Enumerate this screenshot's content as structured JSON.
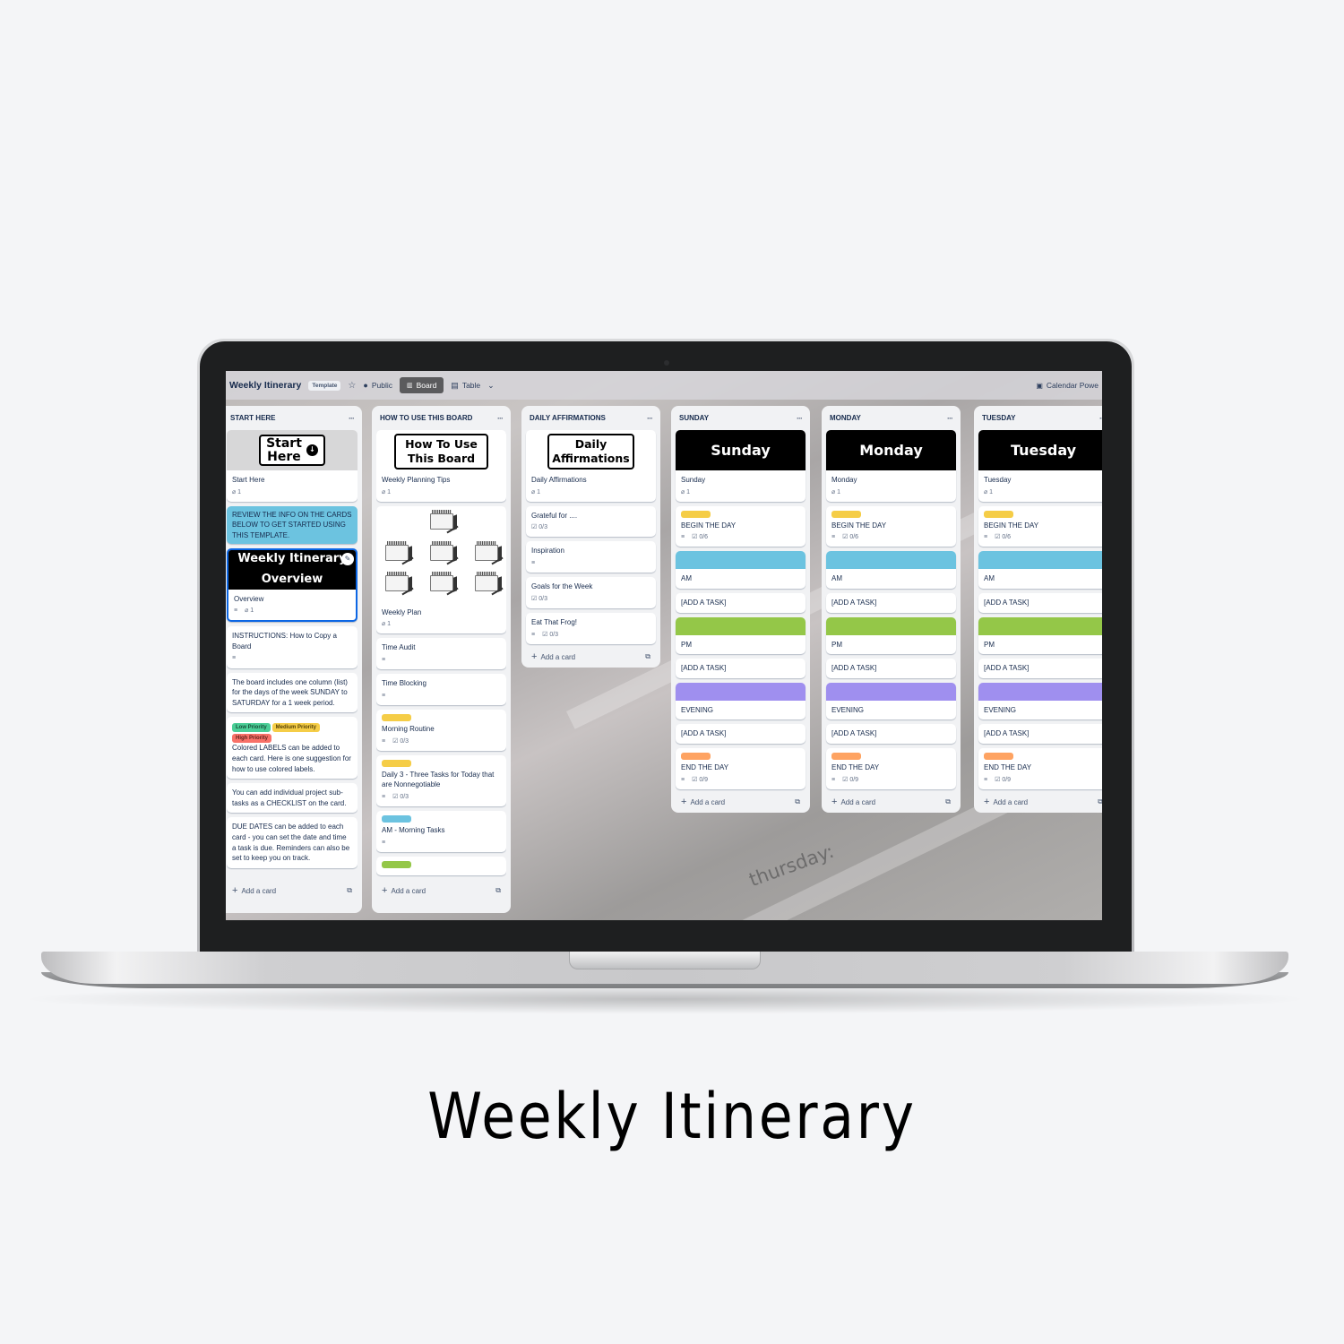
{
  "page_title": "Weekly Itinerary",
  "topbar": {
    "board_title": "Weekly Itinerary",
    "template_badge": "Template",
    "star_icon": "star-icon",
    "visibility": "Public",
    "views": [
      {
        "label": "Board",
        "icon": "board-icon",
        "active": true
      },
      {
        "label": "Table",
        "icon": "table-icon",
        "active": false
      }
    ],
    "more_views_icon": "chevron-down-icon",
    "power_up": "Calendar Powe"
  },
  "background_text": "thursday:",
  "colors": {
    "yellow": "#f5cd47",
    "blue": "#6cc3e0",
    "green": "#94c748",
    "purple": "#9f8fef",
    "orange": "#fea362",
    "low_priority": "#4bce97",
    "medium_priority": "#f5cd47",
    "high_priority": "#f87168"
  },
  "add_card_label": "Add a card",
  "lists": [
    {
      "title": "START HERE",
      "cover_title_1": "Start",
      "cover_title_2": "Here",
      "cards": {
        "start_here": {
          "title": "Start Here",
          "attachments": "1"
        },
        "review": {
          "title": "REVIEW THE INFO ON THE CARDS BELOW TO GET STARTED USING THIS TEMPLATE."
        },
        "overview": {
          "cover_line_1": "Weekly Itinerary",
          "cover_line_2": "Overview",
          "title": "Overview",
          "attachments": "1"
        },
        "instructions": {
          "title": "INSTRUCTIONS: How to Copy a Board"
        },
        "board_info": {
          "title": "The board includes one column (list) for the days of the week SUNDAY to SATURDAY for a 1 week period."
        },
        "labels": {
          "pills": [
            "Low Priority",
            "Medium Priority",
            "High Priority"
          ],
          "title": "Colored LABELS can be added to each card. Here is one suggestion for how to use colored labels."
        },
        "checklist": {
          "title": "You can add individual project sub-tasks as a CHECKLIST on the card."
        },
        "due_dates": {
          "title": "DUE DATES can be added to each card - you can set the date and time a task is due. Reminders can also be set to keep you on track."
        }
      }
    },
    {
      "title": "HOW TO USE THIS BOARD",
      "cover_line_1": "How To Use",
      "cover_line_2": "This Board",
      "cards": {
        "planning_tips": {
          "title": "Weekly Planning Tips",
          "attachments": "1"
        },
        "weekly_plan": {
          "title": "Weekly Plan",
          "attachments": "1"
        },
        "time_audit": {
          "title": "Time Audit"
        },
        "time_blocking": {
          "title": "Time Blocking"
        },
        "morning_routine": {
          "title": "Morning Routine",
          "checklist": "0/3"
        },
        "daily_3": {
          "title": "Daily 3 - Three Tasks for Today that are Nonnegotiable",
          "checklist": "0/3"
        },
        "am_tasks": {
          "title": "AM - Morning Tasks"
        }
      }
    },
    {
      "title": "DAILY AFFIRMATIONS",
      "cover_line_1": "Daily",
      "cover_line_2": "Affirmations",
      "cards": {
        "affirmations": {
          "title": "Daily Affirmations",
          "attachments": "1"
        },
        "grateful": {
          "title": "Grateful for ....",
          "checklist": "0/3"
        },
        "inspiration": {
          "title": "Inspiration"
        },
        "goals": {
          "title": "Goals for the Week",
          "checklist": "0/3"
        },
        "frog": {
          "title": "Eat That Frog!",
          "checklist": "0/3"
        }
      }
    }
  ],
  "days": [
    {
      "title": "SUNDAY",
      "cover": "Sunday",
      "name": "Sunday",
      "attachments": "1",
      "begin": "BEGIN THE DAY",
      "begin_checklist": "0/6",
      "am": "AM",
      "pm": "PM",
      "evening": "EVENING",
      "add_task": "[ADD A TASK]",
      "end": "END THE DAY",
      "end_checklist": "0/9"
    },
    {
      "title": "MONDAY",
      "cover": "Monday",
      "name": "Monday",
      "attachments": "1",
      "begin": "BEGIN THE DAY",
      "begin_checklist": "0/6",
      "am": "AM",
      "pm": "PM",
      "evening": "EVENING",
      "add_task": "[ADD A TASK]",
      "end": "END THE DAY",
      "end_checklist": "0/9"
    },
    {
      "title": "TUESDAY",
      "cover": "Tuesday",
      "name": "Tuesday",
      "attachments": "1",
      "begin": "BEGIN THE DAY",
      "begin_checklist": "0/6",
      "am": "AM",
      "pm": "PM",
      "evening": "EVENING",
      "add_task": "[ADD A TASK]",
      "end": "END THE DAY",
      "end_checklist": "0/9"
    }
  ]
}
